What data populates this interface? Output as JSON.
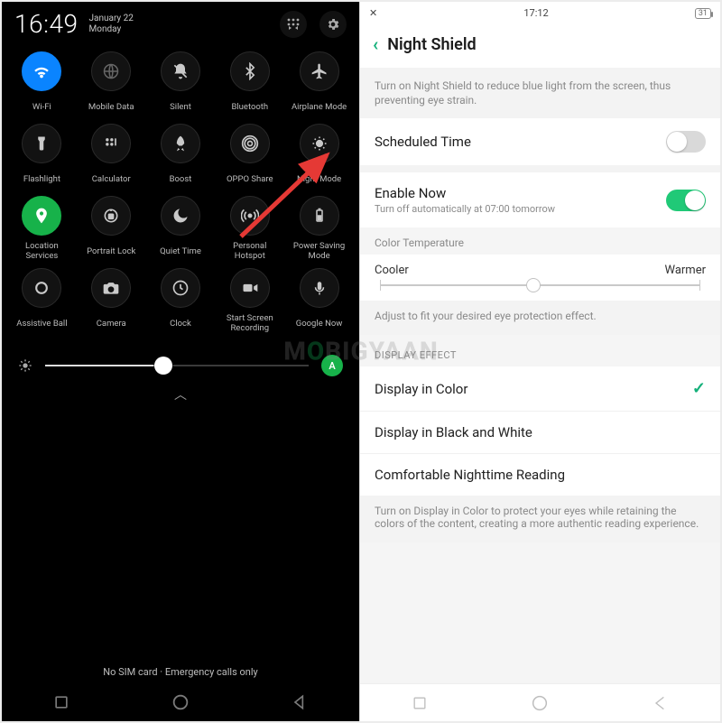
{
  "left": {
    "time": "16:49",
    "date_line1": "January 22",
    "date_line2": "Monday",
    "header_icons": {
      "reorder": "grid-reorder-icon",
      "settings": "gear-icon"
    },
    "tiles": [
      {
        "name": "wifi",
        "label": "Wi-Fi",
        "icon": "wifi-icon",
        "state": "active"
      },
      {
        "name": "mobile-data",
        "label": "Mobile Data",
        "icon": "globe-icon",
        "state": "dim"
      },
      {
        "name": "silent",
        "label": "Silent",
        "icon": "bell-off-icon",
        "state": "off"
      },
      {
        "name": "bluetooth",
        "label": "Bluetooth",
        "icon": "bluetooth-icon",
        "state": "off"
      },
      {
        "name": "airplane",
        "label": "Airplane Mode",
        "icon": "airplane-icon",
        "state": "off"
      },
      {
        "name": "flashlight",
        "label": "Flashlight",
        "icon": "flashlight-icon",
        "state": "off"
      },
      {
        "name": "calculator",
        "label": "Calculator",
        "icon": "calculator-icon",
        "state": "off"
      },
      {
        "name": "boost",
        "label": "Boost",
        "icon": "rocket-icon",
        "state": "off"
      },
      {
        "name": "oppo-share",
        "label": "OPPO Share",
        "icon": "share-icon",
        "state": "off"
      },
      {
        "name": "night-mode",
        "label": "Night Mode",
        "icon": "eye-shield-icon",
        "state": "off"
      },
      {
        "name": "location",
        "label": "Location Services",
        "icon": "location-pin-icon",
        "state": "green"
      },
      {
        "name": "portrait-lock",
        "label": "Portrait Lock",
        "icon": "rotation-lock-icon",
        "state": "off"
      },
      {
        "name": "quiet-time",
        "label": "Quiet Time",
        "icon": "moon-icon",
        "state": "off"
      },
      {
        "name": "hotspot",
        "label": "Personal Hotspot",
        "icon": "hotspot-icon",
        "state": "off"
      },
      {
        "name": "power-save",
        "label": "Power Saving Mode",
        "icon": "battery-icon",
        "state": "off"
      },
      {
        "name": "assistive-ball",
        "label": "Assistive Ball",
        "icon": "circle-ring-icon",
        "state": "off"
      },
      {
        "name": "camera",
        "label": "Camera",
        "icon": "camera-icon",
        "state": "off"
      },
      {
        "name": "clock",
        "label": "Clock",
        "icon": "clock-icon",
        "state": "off"
      },
      {
        "name": "screen-rec",
        "label": "Start Screen Recording",
        "icon": "video-icon",
        "state": "off"
      },
      {
        "name": "google-now",
        "label": "Google Now",
        "icon": "mic-icon",
        "state": "off"
      }
    ],
    "brightness_percent": 45,
    "auto_brightness_label": "A",
    "sim_text": "No SIM card · Emergency calls only"
  },
  "right": {
    "status_time": "17:12",
    "battery_text": "31",
    "title": "Night Shield",
    "intro": "Turn on Night Shield to reduce blue light from the screen, thus preventing eye strain.",
    "scheduled": {
      "label": "Scheduled Time",
      "on": false
    },
    "enable_now": {
      "label": "Enable Now",
      "sub": "Turn off automatically at 07:00 tomorrow",
      "on": true
    },
    "color_temp": {
      "section": "Color Temperature",
      "left": "Cooler",
      "right": "Warmer",
      "value_percent": 48,
      "caption": "Adjust to fit your desired eye protection effect."
    },
    "display_effect": {
      "header": "DISPLAY EFFECT",
      "options": [
        {
          "label": "Display in Color",
          "selected": true
        },
        {
          "label": "Display in Black and White",
          "selected": false
        },
        {
          "label": "Comfortable Nighttime Reading",
          "selected": false
        }
      ],
      "footer": "Turn on Display in Color to protect your eyes while retaining the colors of the content, creating a more authentic reading experience."
    }
  },
  "watermark": {
    "pre": "M",
    "accent": "O",
    "rest": "BIGYAAN"
  }
}
